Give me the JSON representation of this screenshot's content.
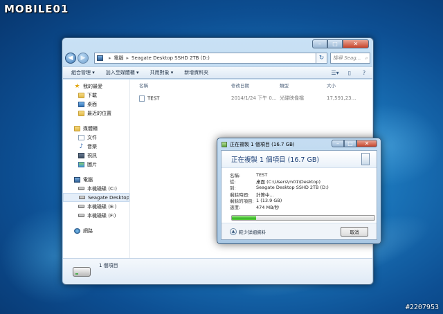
{
  "watermark": "MOBILE01",
  "image_id": "#2207953",
  "explorer": {
    "address": {
      "root": "電腦",
      "current": "Seagate Desktop SSHD 2TB (D:)"
    },
    "search_placeholder": "搜尋 Seag...",
    "toolbar": [
      "組合管理 ▾",
      "加入至媒體櫃 ▾",
      "共用對象 ▾",
      "新增資料夾"
    ],
    "sidebar": {
      "favorites": {
        "header": "我的最愛",
        "items": [
          "下載",
          "桌面",
          "最近的位置"
        ]
      },
      "libraries": {
        "header": "媒體櫃",
        "items": [
          "文件",
          "音樂",
          "視訊",
          "圖片"
        ]
      },
      "computer": {
        "header": "電腦",
        "items": [
          "本機磁碟 (C:)",
          "Seagate Desktop SSHD",
          "本機磁碟 (E:)",
          "本機磁碟 (F:)"
        ]
      },
      "network": {
        "header": "網路"
      }
    },
    "columns": {
      "name": "名稱",
      "modified": "修改日期",
      "type": "類型",
      "size": "大小"
    },
    "files": [
      {
        "name": "TEST",
        "modified": "2014/1/24 下午 0...",
        "type": "光碟映像檔",
        "size": "17,591,23..."
      }
    ],
    "status": "1 個項目"
  },
  "copy_dialog": {
    "title": "正在複製 1 個項目 (16.7 GB)",
    "heading": "正在複製 1 個項目 (16.7 GB)",
    "rows": [
      {
        "key": "名稱:",
        "value": "TEST"
      },
      {
        "key": "從:",
        "value": "桌面 (C:\\Users\\m01\\Desktop)"
      },
      {
        "key": "到:",
        "value": "Seagate Desktop SSHD 2TB (D:)"
      },
      {
        "key": "剩餘時間:",
        "value": "計算中..."
      },
      {
        "key": "剩餘的項目:",
        "value": "1 (13.9 GB)"
      },
      {
        "key": "速度:",
        "value": "474 MB/秒"
      }
    ],
    "progress_fraction": 0.17,
    "more_info": "較少詳細資料",
    "cancel": "取消"
  }
}
